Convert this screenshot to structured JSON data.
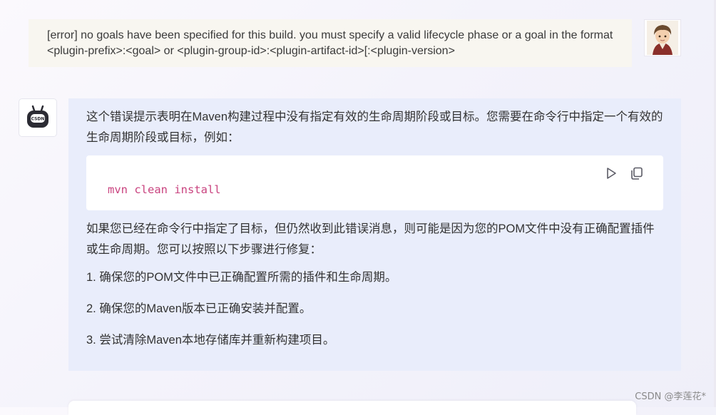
{
  "conversation": {
    "user_message": "[error] no goals have been specified for this build. you must specify a valid lifecycle phase or a goal in the format <plugin-prefix>:<goal> or <plugin-group-id>:<plugin-artifact-id>[:<plugin-version>",
    "assistant": {
      "intro": "这个错误提示表明在Maven构建过程中没有指定有效的生命周期阶段或目标。您需要在命令行中指定一个有效的生命周期阶段或目标，例如：",
      "code": "mvn clean install",
      "followup": "如果您已经在命令行中指定了目标，但仍然收到此错误消息，则可能是因为您的POM文件中没有正确配置插件或生命周期。您可以按照以下步骤进行修复：",
      "steps": [
        "1. 确保您的POM文件中已正确配置所需的插件和生命周期。",
        "2. 确保您的Maven版本已正确安装并配置。",
        "3. 尝试清除Maven本地存储库并重新构建项目。"
      ]
    }
  },
  "icons": {
    "bot_avatar": "robot-icon",
    "bot_badge_text": "CSDN",
    "run": "play-icon",
    "copy": "copy-icon",
    "user_avatar": "user-avatar-icon"
  },
  "footer": {
    "credit": "CSDN @李莲花*"
  },
  "colors": {
    "answer_bg": "#e9edfb",
    "user_bg": "#f8f6f0",
    "code_text": "#c9437f"
  }
}
